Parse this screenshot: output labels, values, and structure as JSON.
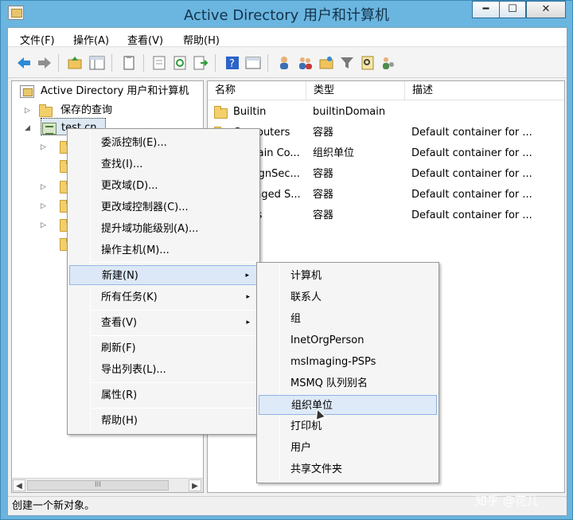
{
  "window": {
    "title": "Active Directory 用户和计算机",
    "min_glyph": "━",
    "max_glyph": "☐",
    "close_glyph": "✕"
  },
  "menubar": [
    {
      "label": "文件(F)"
    },
    {
      "label": "操作(A)"
    },
    {
      "label": "查看(V)"
    },
    {
      "label": "帮助(H)"
    }
  ],
  "toolbar": {
    "icons": [
      "back-arrow-icon",
      "forward-arrow-icon",
      "up-folder-icon",
      "show-tree-icon",
      "copy-icon",
      "properties-icon",
      "refresh-icon",
      "export-list-icon",
      "help-icon",
      "console-icon",
      "add-user-icon",
      "add-group-icon",
      "add-ou-icon",
      "filter-icon",
      "find-icon",
      "delegate-icon"
    ]
  },
  "tree": {
    "root": "Active Directory 用户和计算机",
    "saved_queries": "保存的查询",
    "domain": "test.cn"
  },
  "list": {
    "headers": [
      "名称",
      "类型",
      "描述"
    ],
    "rows": [
      {
        "name": "Builtin",
        "type": "builtinDomain",
        "desc": ""
      },
      {
        "name": "Computers",
        "type": "容器",
        "desc": "Default container for ..."
      },
      {
        "name": "Domain Co...",
        "type": "组织单位",
        "desc": "Default container for ..."
      },
      {
        "name": "ForeignSec...",
        "type": "容器",
        "desc": "Default container for ..."
      },
      {
        "name": "Managed S...",
        "type": "容器",
        "desc": "Default container for ..."
      },
      {
        "name": "Users",
        "type": "容器",
        "desc": "Default container for ..."
      }
    ]
  },
  "context_menu": {
    "items": [
      "委派控制(E)...",
      "查找(I)...",
      "更改域(D)...",
      "更改域控制器(C)...",
      "提升域功能级别(A)...",
      "操作主机(M)...",
      "新建(N)",
      "所有任务(K)",
      "查看(V)",
      "刷新(F)",
      "导出列表(L)...",
      "属性(R)",
      "帮助(H)"
    ],
    "arrow": "▸"
  },
  "submenu": {
    "items": [
      "计算机",
      "联系人",
      "组",
      "InetOrgPerson",
      "msImaging-PSPs",
      "MSMQ 队列别名",
      "组织单位",
      "打印机",
      "用户",
      "共享文件夹"
    ]
  },
  "status": "创建一个新对象。",
  "watermark": "知乎 @花儿",
  "scroll": {
    "left": "◀",
    "right": "▶",
    "thumb": "III"
  },
  "colors": {
    "accent": "#6ab4de",
    "highlight": "#dce8f7"
  }
}
